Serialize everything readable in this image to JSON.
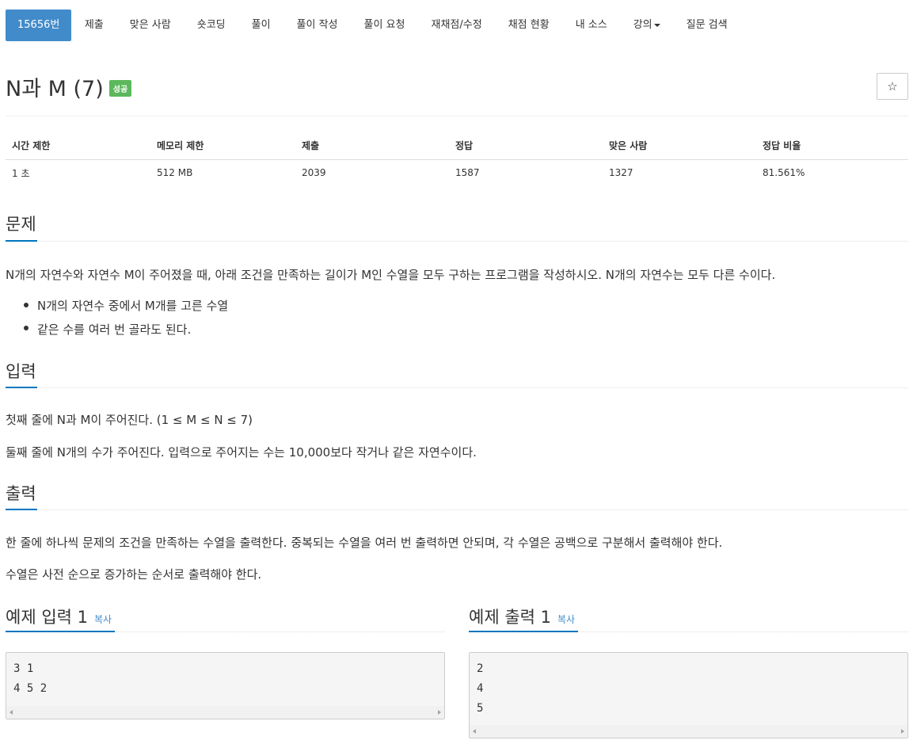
{
  "nav": {
    "items": [
      {
        "label": "15656번",
        "active": true
      },
      {
        "label": "제출"
      },
      {
        "label": "맞은 사람"
      },
      {
        "label": "숏코딩"
      },
      {
        "label": "풀이"
      },
      {
        "label": "풀이 작성"
      },
      {
        "label": "풀이 요청"
      },
      {
        "label": "재채점/수정"
      },
      {
        "label": "채점 현황"
      },
      {
        "label": "내 소스"
      },
      {
        "label": "강의"
      },
      {
        "label": "질문 검색"
      }
    ]
  },
  "problem": {
    "title": "N과 M (7)",
    "badge": "성공",
    "star_icon": "☆"
  },
  "info": {
    "headers": [
      "시간 제한",
      "메모리 제한",
      "제출",
      "정답",
      "맞은 사람",
      "정답 비율"
    ],
    "values": [
      "1 초",
      "512 MB",
      "2039",
      "1587",
      "1327",
      "81.561%"
    ]
  },
  "sections": {
    "problem_title": "문제",
    "problem_desc": "N개의 자연수와 자연수 M이 주어졌을 때, 아래 조건을 만족하는 길이가 M인 수열을 모두 구하는 프로그램을 작성하시오. N개의 자연수는 모두 다른 수이다.",
    "bullets": [
      "N개의 자연수 중에서 M개를 고른 수열",
      "같은 수를 여러 번 골라도 된다."
    ],
    "input_title": "입력",
    "input_line1": "첫째 줄에 N과 M이 주어진다. (1 ≤ M ≤ N ≤ 7)",
    "input_line2": "둘째 줄에 N개의 수가 주어진다. 입력으로 주어지는 수는 10,000보다 작거나 같은 자연수이다.",
    "output_title": "출력",
    "output_line1": "한 줄에 하나씩 문제의 조건을 만족하는 수열을 출력한다. 중복되는 수열을 여러 번 출력하면 안되며, 각 수열은 공백으로 구분해서 출력해야 한다.",
    "output_line2": "수열은 사전 순으로 증가하는 순서로 출력해야 한다."
  },
  "samples": {
    "input_title": "예제 입력 1",
    "output_title": "예제 출력 1",
    "copy_label": "복사",
    "input_lines": [
      "3 1",
      "4 5 2"
    ],
    "output_lines": [
      "2",
      "4",
      "5"
    ]
  },
  "colors": {
    "primary": "#428bca",
    "success": "#5cb85c",
    "section_accent": "#0076c0"
  }
}
